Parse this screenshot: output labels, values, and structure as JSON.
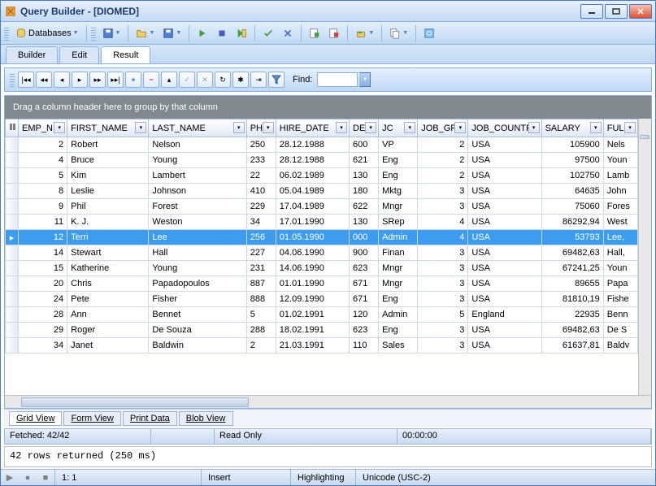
{
  "window": {
    "title": "Query Builder - [DIOMED]"
  },
  "toolbar": {
    "databases_label": "Databases"
  },
  "tabs": {
    "builder": "Builder",
    "edit": "Edit",
    "result": "Result"
  },
  "gridToolbar": {
    "find_label": "Find:",
    "find_value": ""
  },
  "groupBar": {
    "hint": "Drag a column header here to group by that column"
  },
  "columns": [
    "EMP_N",
    "FIRST_NAME",
    "LAST_NAME",
    "PH",
    "HIRE_DATE",
    "DE",
    "JC",
    "JOB_GF",
    "JOB_COUNTR",
    "SALARY",
    "FULL"
  ],
  "rows": [
    {
      "emp_no": 2,
      "first": "Robert",
      "last": "Nelson",
      "ph": "250",
      "hire": "28.12.1988",
      "de": "600",
      "jc": "VP",
      "gf": 2,
      "country": "USA",
      "salary": "105900",
      "full": "Nels"
    },
    {
      "emp_no": 4,
      "first": "Bruce",
      "last": "Young",
      "ph": "233",
      "hire": "28.12.1988",
      "de": "621",
      "jc": "Eng",
      "gf": 2,
      "country": "USA",
      "salary": "97500",
      "full": "Youn"
    },
    {
      "emp_no": 5,
      "first": "Kim",
      "last": "Lambert",
      "ph": "22",
      "hire": "06.02.1989",
      "de": "130",
      "jc": "Eng",
      "gf": 2,
      "country": "USA",
      "salary": "102750",
      "full": "Lamb"
    },
    {
      "emp_no": 8,
      "first": "Leslie",
      "last": "Johnson",
      "ph": "410",
      "hire": "05.04.1989",
      "de": "180",
      "jc": "Mktg",
      "gf": 3,
      "country": "USA",
      "salary": "64635",
      "full": "John"
    },
    {
      "emp_no": 9,
      "first": "Phil",
      "last": "Forest",
      "ph": "229",
      "hire": "17.04.1989",
      "de": "622",
      "jc": "Mngr",
      "gf": 3,
      "country": "USA",
      "salary": "75060",
      "full": "Fores"
    },
    {
      "emp_no": 11,
      "first": "K. J.",
      "last": "Weston",
      "ph": "34",
      "hire": "17.01.1990",
      "de": "130",
      "jc": "SRep",
      "gf": 4,
      "country": "USA",
      "salary": "86292,94",
      "full": "West"
    },
    {
      "emp_no": 12,
      "first": "Terri",
      "last": "Lee",
      "ph": "256",
      "hire": "01.05.1990",
      "de": "000",
      "jc": "Admin",
      "gf": 4,
      "country": "USA",
      "salary": "53793",
      "full": "Lee,",
      "selected": true
    },
    {
      "emp_no": 14,
      "first": "Stewart",
      "last": "Hall",
      "ph": "227",
      "hire": "04.06.1990",
      "de": "900",
      "jc": "Finan",
      "gf": 3,
      "country": "USA",
      "salary": "69482,63",
      "full": "Hall,"
    },
    {
      "emp_no": 15,
      "first": "Katherine",
      "last": "Young",
      "ph": "231",
      "hire": "14.06.1990",
      "de": "623",
      "jc": "Mngr",
      "gf": 3,
      "country": "USA",
      "salary": "67241,25",
      "full": "Youn"
    },
    {
      "emp_no": 20,
      "first": "Chris",
      "last": "Papadopoulos",
      "ph": "887",
      "hire": "01.01.1990",
      "de": "671",
      "jc": "Mngr",
      "gf": 3,
      "country": "USA",
      "salary": "89655",
      "full": "Papa"
    },
    {
      "emp_no": 24,
      "first": "Pete",
      "last": "Fisher",
      "ph": "888",
      "hire": "12.09.1990",
      "de": "671",
      "jc": "Eng",
      "gf": 3,
      "country": "USA",
      "salary": "81810,19",
      "full": "Fishe"
    },
    {
      "emp_no": 28,
      "first": "Ann",
      "last": "Bennet",
      "ph": "5",
      "hire": "01.02.1991",
      "de": "120",
      "jc": "Admin",
      "gf": 5,
      "country": "England",
      "salary": "22935",
      "full": "Benn"
    },
    {
      "emp_no": 29,
      "first": "Roger",
      "last": "De Souza",
      "ph": "288",
      "hire": "18.02.1991",
      "de": "623",
      "jc": "Eng",
      "gf": 3,
      "country": "USA",
      "salary": "69482,63",
      "full": "De S"
    },
    {
      "emp_no": 34,
      "first": "Janet",
      "last": "Baldwin",
      "ph": "2",
      "hire": "21.03.1991",
      "de": "110",
      "jc": "Sales",
      "gf": 3,
      "country": "USA",
      "salary": "61637,81",
      "full": "Baldv"
    }
  ],
  "bottomTabs": {
    "grid": "Grid View",
    "form": "Form View",
    "print": "Print Data",
    "blob": "Blob View"
  },
  "status1": {
    "fetched": "Fetched: 42/42",
    "readonly": "Read Only",
    "time": "00:00:00"
  },
  "console": {
    "text": "42 rows returned (250 ms)"
  },
  "status2": {
    "pos": "1:   1",
    "insert": "Insert",
    "highlight": "Highlighting",
    "encoding": "Unicode (USC-2)"
  }
}
